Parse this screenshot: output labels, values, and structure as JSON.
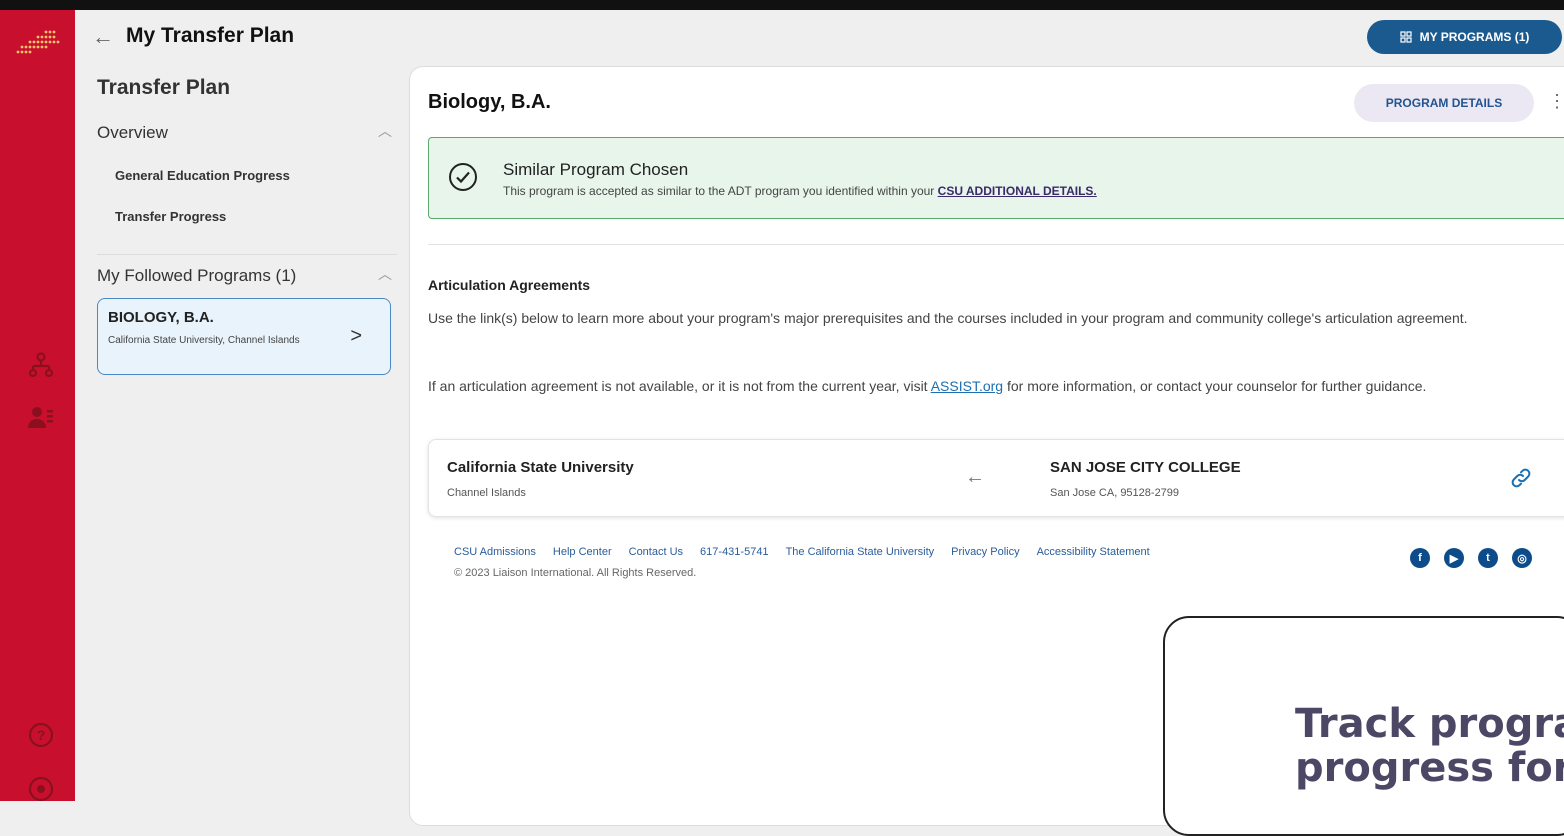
{
  "header": {
    "title": "My Transfer Plan",
    "my_programs_label": "MY PROGRAMS (1)"
  },
  "left_panel": {
    "title": "Transfer Plan",
    "overview": {
      "heading": "Overview",
      "items": [
        "General Education Progress",
        "Transfer Progress"
      ]
    },
    "followed": {
      "heading": "My Followed Programs (1)",
      "program": {
        "title": "BIOLOGY, B.A.",
        "subtitle": "California State University, Channel Islands"
      }
    }
  },
  "main": {
    "program_title": "Biology, B.A.",
    "program_details_label": "PROGRAM DETAILS",
    "similar": {
      "title": "Similar Program Chosen",
      "text": "This program is accepted as similar to the ADT program you identified within your",
      "link": "CSU ADDITIONAL DETAILS."
    },
    "articulation": {
      "heading": "Articulation Agreements",
      "para1": "Use the link(s) below to learn more about your program's major prerequisites and the courses included in your program and community college's articulation agreement.",
      "para2_before": "If an articulation agreement is not available, or it is not from the current year, visit",
      "para2_link": "ASSIST.org",
      "para2_after": "for more information, or contact your counselor for further guidance."
    },
    "agreement": {
      "from_name": "California State University",
      "from_location": "Channel Islands",
      "to_name": "SAN JOSE CITY COLLEGE",
      "to_location": "San Jose CA, 95128-2799"
    }
  },
  "footer": {
    "links": [
      "CSU Admissions",
      "Help Center",
      "Contact Us",
      "617-431-5741",
      "The California State University",
      "Privacy Policy",
      "Accessibility Statement"
    ],
    "copyright": "© 2023 Liaison International. All Rights Reserved.",
    "social": [
      "facebook-icon",
      "youtube-icon",
      "twitter-icon",
      "instagram-icon"
    ]
  },
  "tooltip": {
    "line1": "Track progra",
    "line2": "progress for"
  },
  "colors": {
    "rail": "#c8102e",
    "primary": "#1b5a8f",
    "success_bg": "#e7f5ea",
    "success_border": "#5aa86b"
  }
}
